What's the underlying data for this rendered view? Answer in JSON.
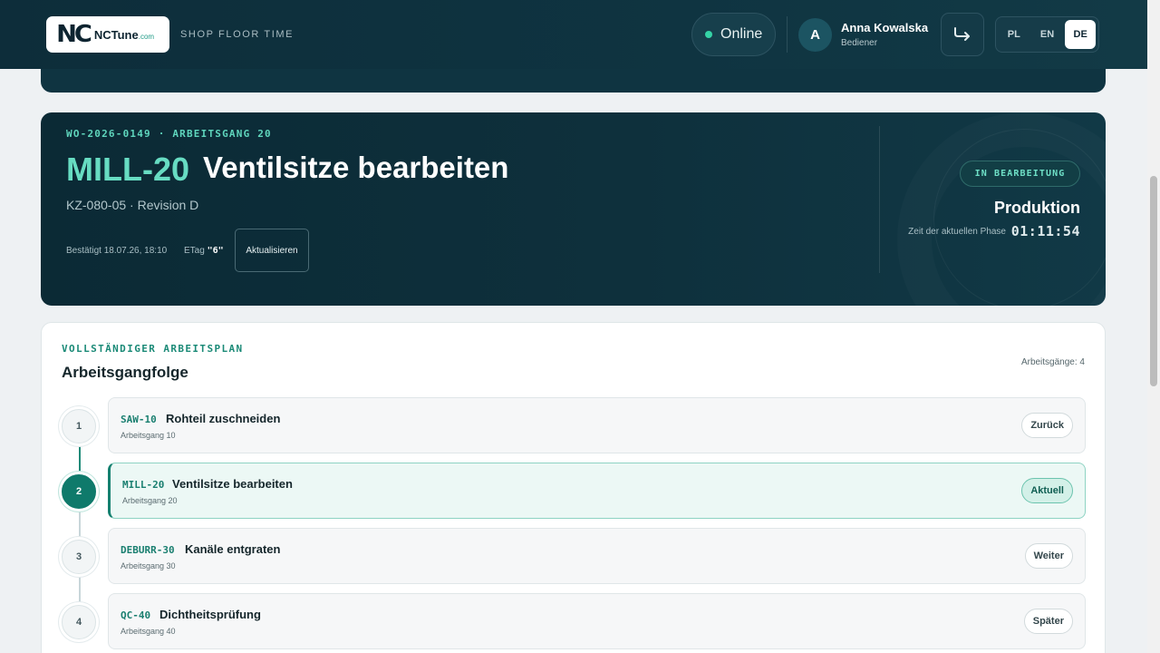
{
  "header": {
    "logo_mark": "NC",
    "logo_text": "NCTune",
    "logo_domain": ".com",
    "tagline": "SHOP FLOOR TIME",
    "status": "Online",
    "user": {
      "initial": "A",
      "name": "Anna Kowalska",
      "role": "Bediener"
    },
    "languages": [
      "PL",
      "EN",
      "DE"
    ],
    "active_language": "DE"
  },
  "work_order": {
    "kicker": "WO-2026-0149 · ARBEITSGANG 20",
    "code": "MILL-20",
    "title": "Ventilsitze bearbeiten",
    "subtitle": "KZ-080-05 · Revision D",
    "confirmed": "Bestätigt 18.07.26, 18:10",
    "etag_label": "ETag",
    "etag_value": "\"6\"",
    "refresh_label": "Aktualisieren",
    "status": "IN BEARBEITUNG",
    "phase": "Produktion",
    "phase_time_label": "Zeit der aktuellen Phase",
    "phase_time": "01:11:54"
  },
  "routing": {
    "kicker": "VOLLSTÄNDIGER ARBEITSPLAN",
    "title": "Arbeitsgangfolge",
    "count": "Arbeitsgänge: 4",
    "operations": [
      {
        "step": "1",
        "code": "SAW-10",
        "name": "Rohteil zuschneiden",
        "sub": "Arbeitsgang 10",
        "action": "Zurück"
      },
      {
        "step": "2",
        "code": "MILL-20",
        "name": "Ventilsitze bearbeiten",
        "sub": "Arbeitsgang 20",
        "action": "Aktuell"
      },
      {
        "step": "3",
        "code": "DEBURR-30",
        "name": "Kanäle entgraten",
        "sub": "Arbeitsgang 30",
        "action": "Weiter"
      },
      {
        "step": "4",
        "code": "QC-40",
        "name": "Dichtheitsprüfung",
        "sub": "Arbeitsgang 40",
        "action": "Später"
      }
    ]
  },
  "colors": {
    "accent": "#1b8a77",
    "header_bg": "#0f3441",
    "online_dot": "#35d3a6"
  }
}
